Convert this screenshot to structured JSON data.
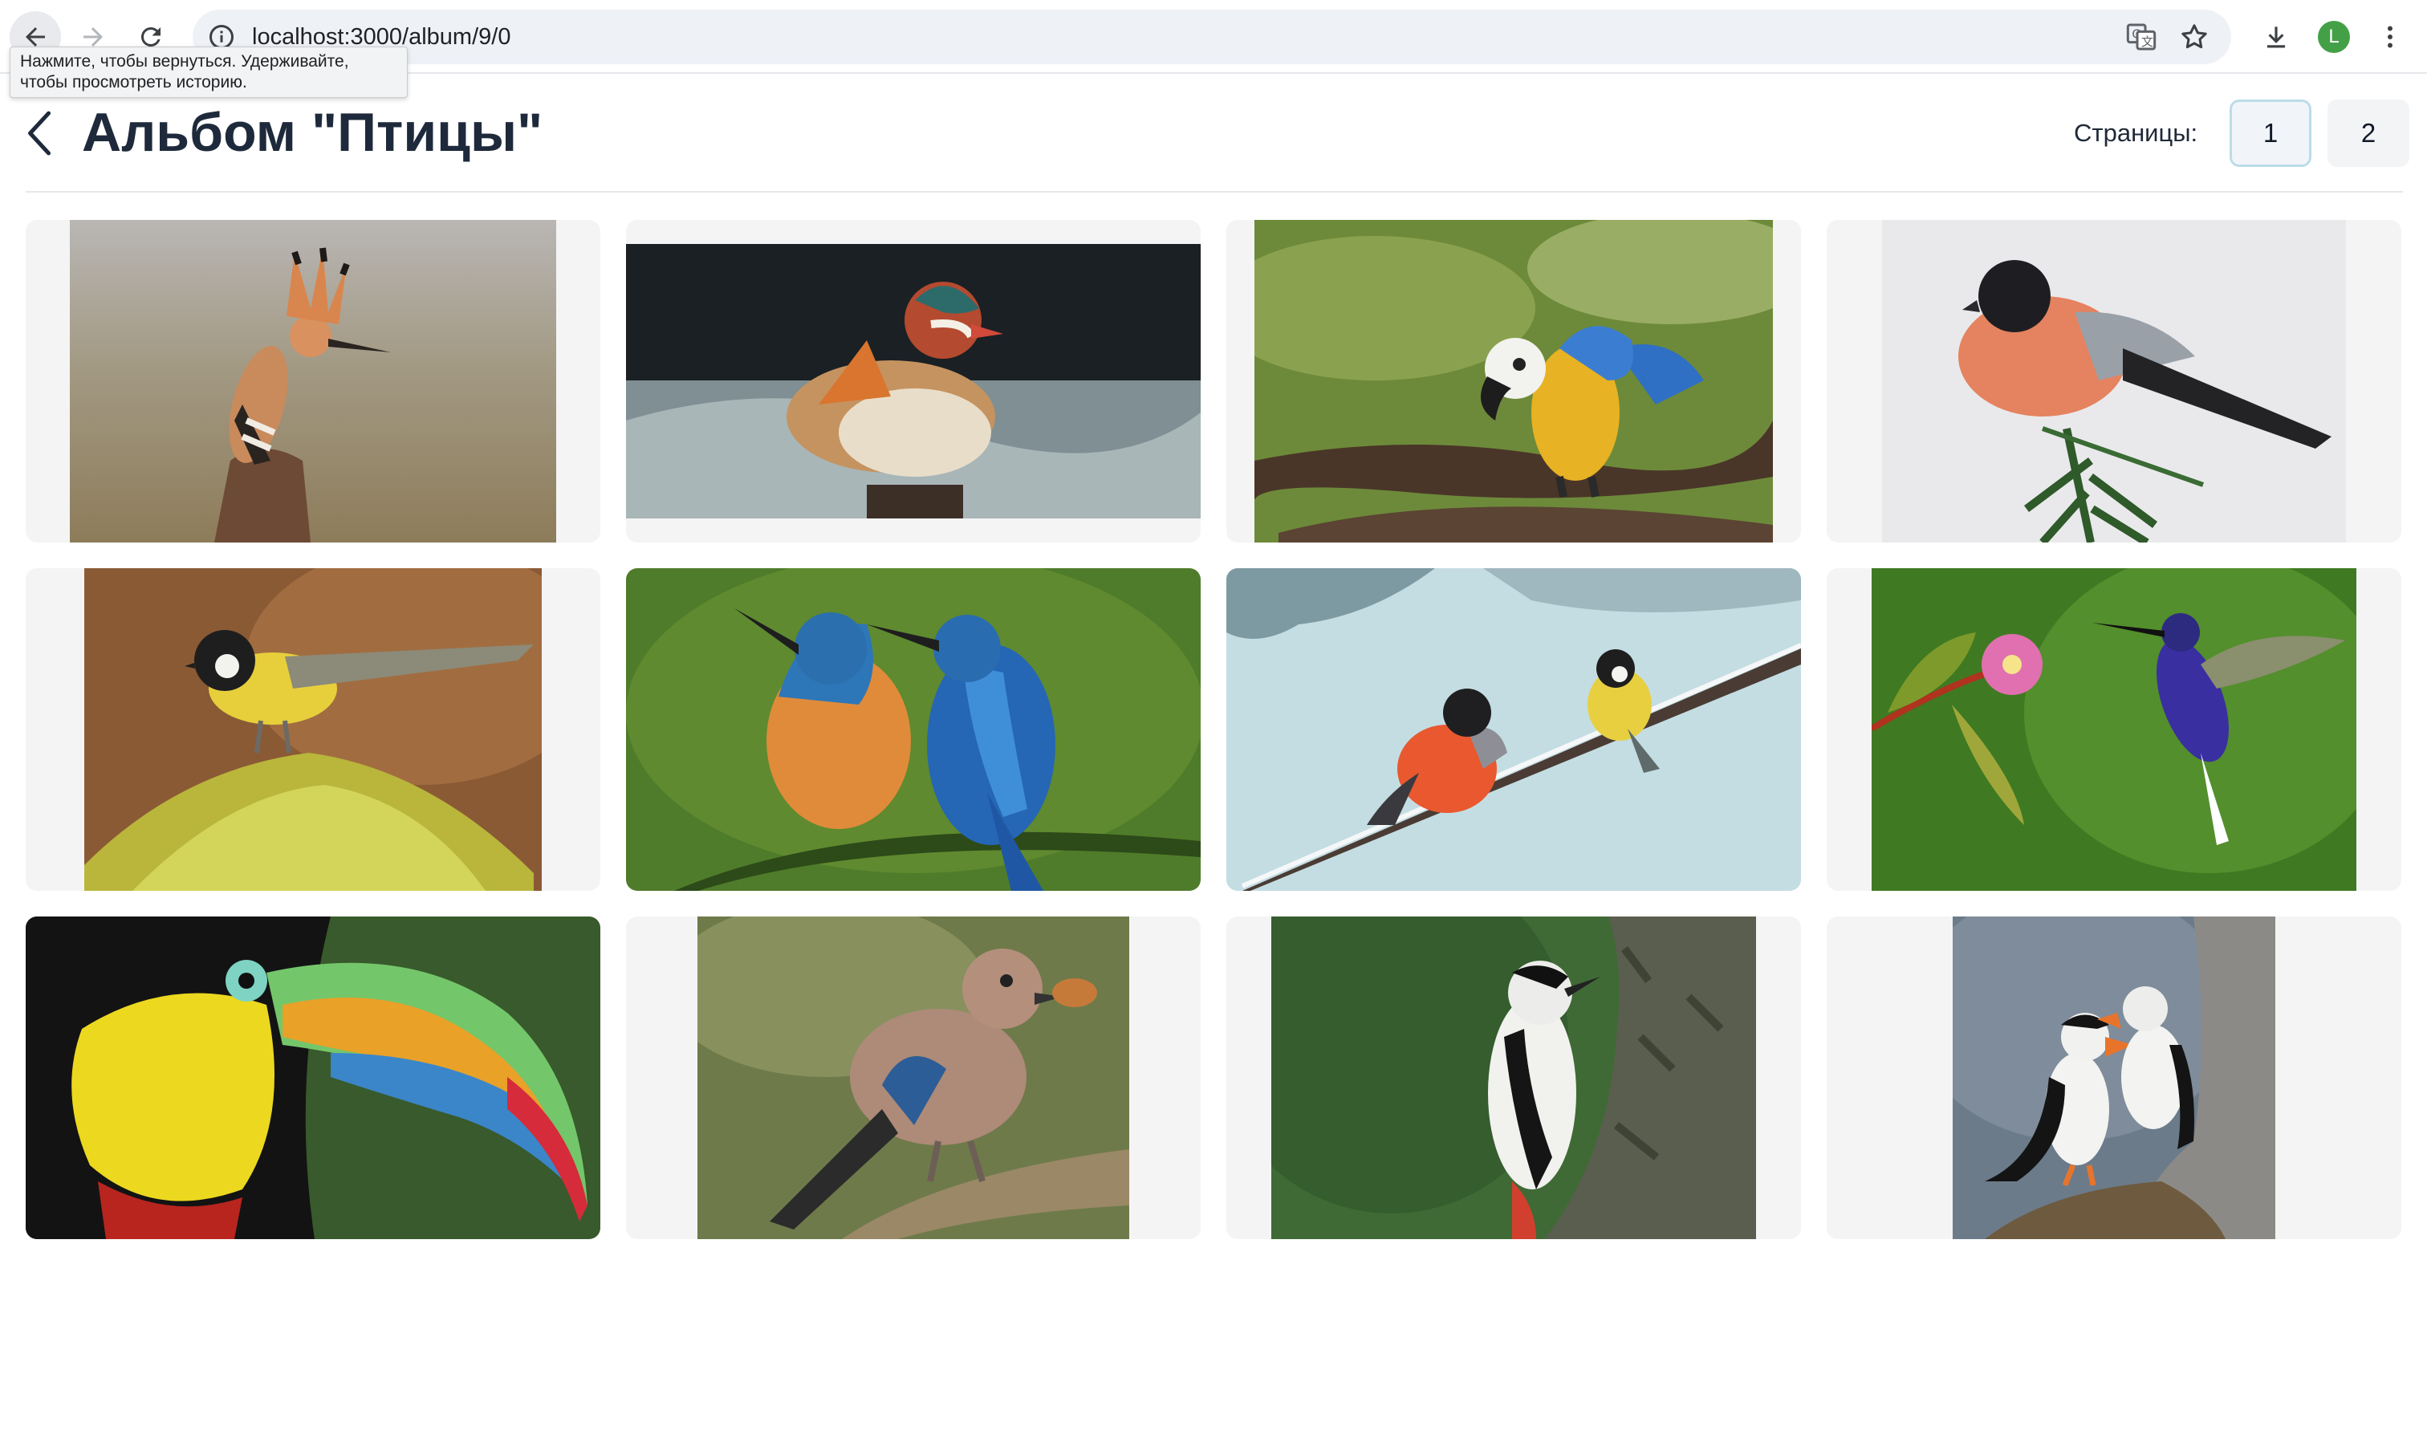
{
  "browser": {
    "url": "localhost:3000/album/9/0",
    "profile_initial": "L",
    "back_tooltip": "Нажмите, чтобы вернуться. Удерживайте, чтобы просмотреть историю.",
    "accent_color": "#43a047"
  },
  "header": {
    "title": "Альбом \"Птицы\"",
    "pages_label": "Страницы:",
    "pages": [
      "1",
      "2"
    ],
    "current_page": "1"
  },
  "photos": [
    {
      "subject": "hoopoe",
      "icon": "bird-photo"
    },
    {
      "subject": "mandarin-duck",
      "icon": "bird-photo"
    },
    {
      "subject": "macaw",
      "icon": "bird-photo"
    },
    {
      "subject": "bullfinch",
      "icon": "bird-photo"
    },
    {
      "subject": "great-tit",
      "icon": "bird-photo"
    },
    {
      "subject": "kingfishers",
      "icon": "bird-photo"
    },
    {
      "subject": "bullfinch-and-tit-in-snow",
      "icon": "bird-photo"
    },
    {
      "subject": "hummingbird",
      "icon": "bird-photo"
    },
    {
      "subject": "toucan",
      "icon": "bird-photo"
    },
    {
      "subject": "jay",
      "icon": "bird-photo"
    },
    {
      "subject": "woodpecker",
      "icon": "bird-photo"
    },
    {
      "subject": "puffins",
      "icon": "bird-photo"
    }
  ]
}
